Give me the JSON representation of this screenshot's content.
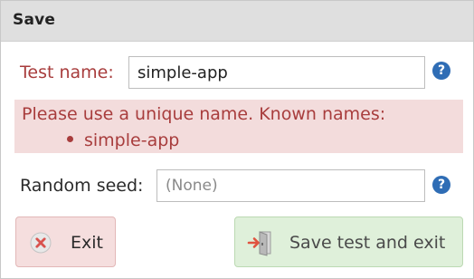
{
  "dialog": {
    "title": "Save"
  },
  "test_name": {
    "label": "Test name:",
    "value": "simple-app",
    "help_glyph": "?"
  },
  "error": {
    "message": "Please use a unique name. Known names:",
    "known_names": [
      "simple-app"
    ]
  },
  "random_seed": {
    "label": "Random seed:",
    "value": "",
    "placeholder": "(None)",
    "help_glyph": "?"
  },
  "buttons": {
    "exit_label": "Exit",
    "save_label": "Save test and exit"
  },
  "icons": {
    "help": "question-circle-icon",
    "exit": "times-circle-icon",
    "save": "sign-out-door-icon"
  },
  "colors": {
    "error_text": "#a83d3d",
    "error_bg": "#f3dcdc",
    "help_icon": "#2f6db5",
    "exit_button_bg": "#f5dede",
    "save_button_bg": "#dff0da",
    "header_bg": "#dfdfdf"
  }
}
